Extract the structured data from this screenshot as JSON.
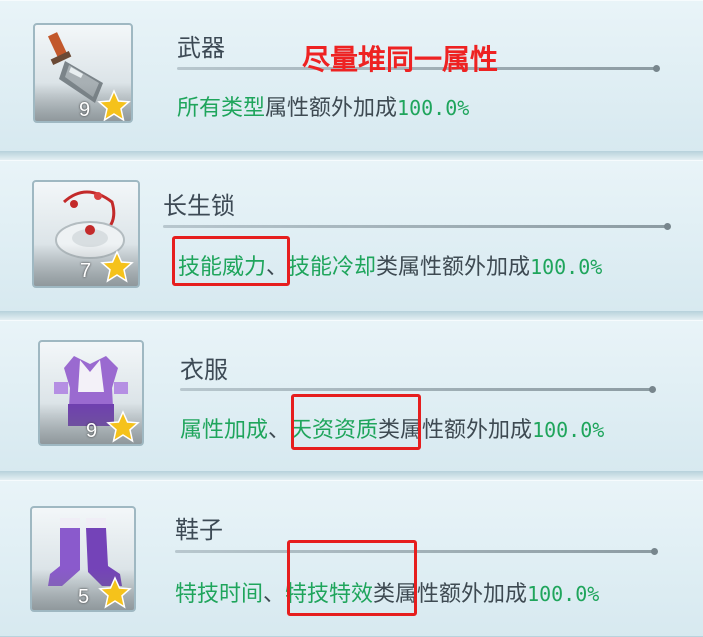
{
  "items": [
    {
      "title": "武器",
      "level": "9",
      "desc_parts": [
        {
          "text": "所有类型",
          "color": "green"
        },
        {
          "text": "属性额外加成",
          "color": "dark"
        },
        {
          "text": "100.0%",
          "color": "pct"
        }
      ]
    },
    {
      "title": "长生锁",
      "level": "7",
      "desc_parts": [
        {
          "text": "技能威力",
          "color": "green"
        },
        {
          "text": "、",
          "color": "dark"
        },
        {
          "text": "技能冷却",
          "color": "green"
        },
        {
          "text": "类属性额外加成",
          "color": "dark"
        },
        {
          "text": "100.0%",
          "color": "pct"
        }
      ]
    },
    {
      "title": "衣服",
      "level": "9",
      "desc_parts": [
        {
          "text": "属性加成",
          "color": "green"
        },
        {
          "text": "、",
          "color": "dark"
        },
        {
          "text": "天资资质",
          "color": "green"
        },
        {
          "text": "类属性额外加成",
          "color": "dark"
        },
        {
          "text": "100.0%",
          "color": "pct"
        }
      ]
    },
    {
      "title": "鞋子",
      "level": "5",
      "desc_parts": [
        {
          "text": "特技时间",
          "color": "green"
        },
        {
          "text": "、",
          "color": "dark"
        },
        {
          "text": "特技特效",
          "color": "green"
        },
        {
          "text": "类属性额外加成",
          "color": "dark"
        },
        {
          "text": "100.0%",
          "color": "pct"
        }
      ]
    }
  ],
  "annotation": "尽量堆同一属性",
  "colors": {
    "green": "#1fa55c",
    "dark": "#3e4a52",
    "annotation_red": "#ee2222",
    "star": "#f5c21b"
  },
  "icons": [
    "blade-weapon-icon",
    "longevity-lock-icon",
    "robe-clothing-icon",
    "boots-icon",
    "star-icon"
  ]
}
